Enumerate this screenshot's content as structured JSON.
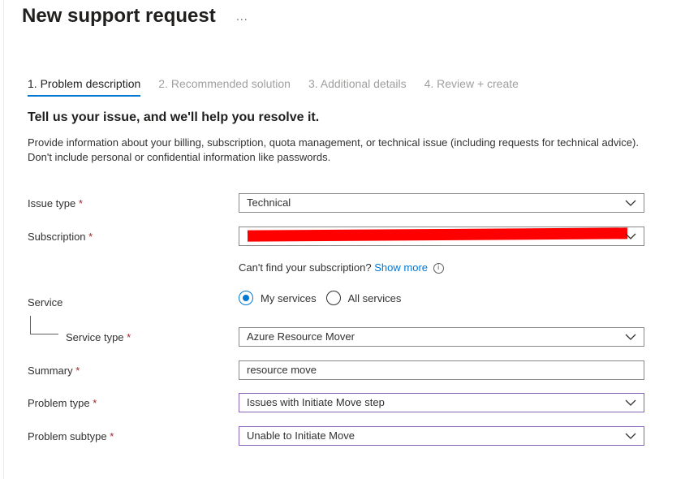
{
  "header": {
    "title": "New support request",
    "more_label": "..."
  },
  "tabs": [
    {
      "label": "1. Problem description",
      "active": true
    },
    {
      "label": "2. Recommended solution",
      "active": false
    },
    {
      "label": "3. Additional details",
      "active": false
    },
    {
      "label": "4. Review + create",
      "active": false
    }
  ],
  "intro": {
    "heading": "Tell us your issue, and we'll help you resolve it.",
    "description": "Provide information about your billing, subscription, quota management, or technical issue (including requests for technical advice). Don't include personal or confidential information like passwords."
  },
  "form": {
    "required_marker": "*",
    "issue_type": {
      "label": "Issue type",
      "value": "Technical"
    },
    "subscription": {
      "label": "Subscription",
      "value": "",
      "redacted": true
    },
    "subscription_hint": {
      "text": "Can't find your subscription?",
      "link": "Show more",
      "icon": "info-icon"
    },
    "service": {
      "label": "Service",
      "options": [
        "My services",
        "All services"
      ],
      "selected": "My services"
    },
    "service_type": {
      "label": "Service type",
      "value": "Azure Resource Mover"
    },
    "summary": {
      "label": "Summary",
      "value": "resource move"
    },
    "problem_type": {
      "label": "Problem type",
      "value": "Issues with Initiate Move step"
    },
    "problem_subtype": {
      "label": "Problem subtype",
      "value": "Unable to Initiate Move"
    }
  },
  "colors": {
    "accent": "#0078d4",
    "required": "#a4262c",
    "focus_border": "#8764b8",
    "redaction": "#ff0000"
  }
}
